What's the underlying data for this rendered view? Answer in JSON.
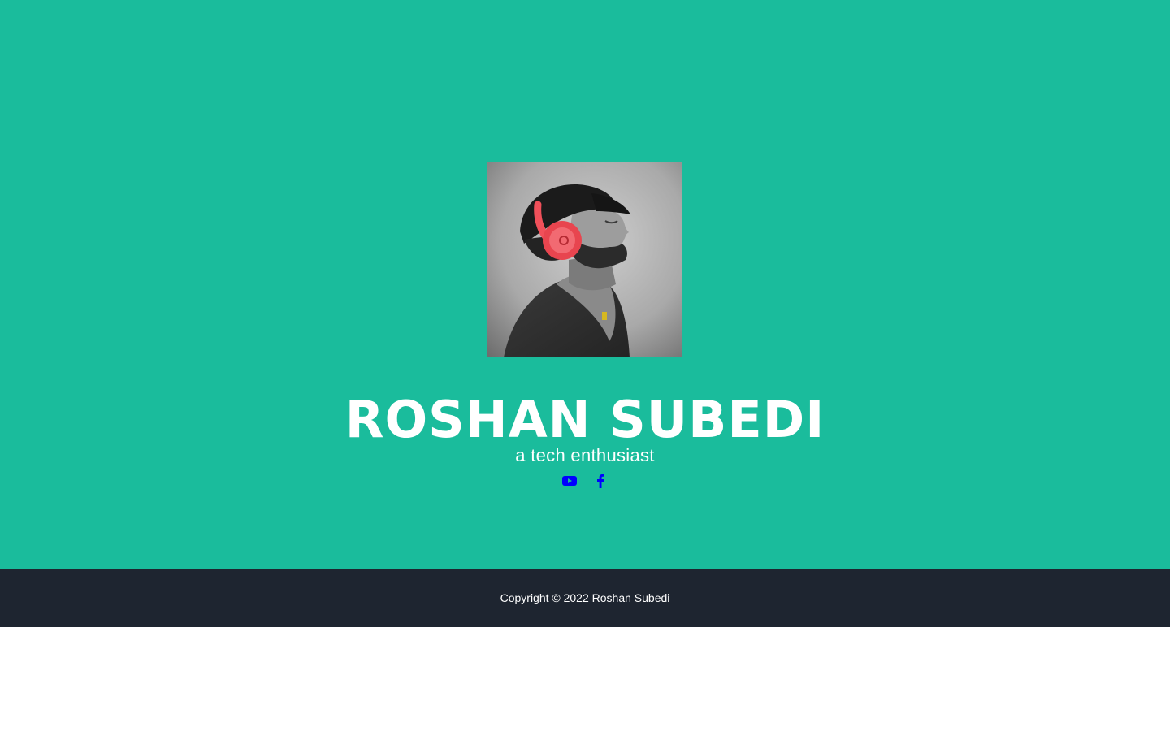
{
  "profile": {
    "name": "ROSHAN SUBEDI",
    "tagline": "a tech enthusiast",
    "photo_icon": "profile-photo"
  },
  "social": {
    "links": [
      {
        "icon": "youtube-icon",
        "color": "#0000ff"
      },
      {
        "icon": "facebook-icon",
        "color": "#0000ff"
      }
    ]
  },
  "footer": {
    "copyright": "Copyright © 2022 Roshan Subedi"
  },
  "colors": {
    "hero_background": "#1abc9c",
    "footer_background": "#1e2530",
    "text": "#ffffff",
    "headphones_accent": "#f0505a"
  }
}
